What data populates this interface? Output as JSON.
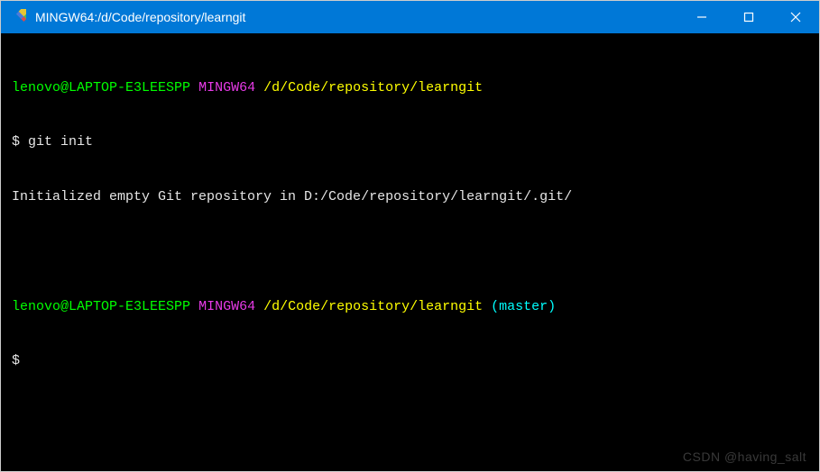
{
  "titlebar": {
    "title": "MINGW64:/d/Code/repository/learngit"
  },
  "colors": {
    "titlebar_bg": "#0078d7",
    "terminal_bg": "#000000",
    "green": "#00ff00",
    "magenta": "#e83ae8",
    "yellow": "#ffff00",
    "white": "#e6e6e6",
    "cyan": "#00ffff"
  },
  "prompt1": {
    "user_host": "lenovo@LAPTOP-E3LEESPP",
    "env": "MINGW64",
    "path": "/d/Code/repository/learngit",
    "symbol": "$",
    "command": "git init"
  },
  "output1": {
    "text": "Initialized empty Git repository in D:/Code/repository/learngit/.git/"
  },
  "prompt2": {
    "user_host": "lenovo@LAPTOP-E3LEESPP",
    "env": "MINGW64",
    "path": "/d/Code/repository/learngit",
    "branch": "(master)",
    "symbol": "$"
  },
  "watermark": "CSDN @having_salt"
}
